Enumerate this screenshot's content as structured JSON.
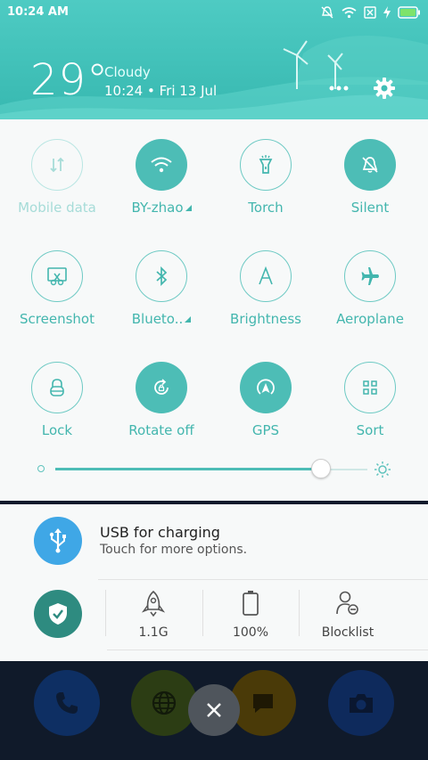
{
  "status_bar": {
    "time": "10:24 AM"
  },
  "header": {
    "temperature": "29°",
    "condition": "Cloudy",
    "datetime": "10:24 • Fri 13 Jul"
  },
  "tiles": [
    {
      "label": "Mobile data",
      "icon": "mobile-data-icon",
      "state": "disabled"
    },
    {
      "label": "BY-zhao",
      "icon": "wifi-icon",
      "state": "on",
      "expandable": true
    },
    {
      "label": "Torch",
      "icon": "torch-icon",
      "state": "off"
    },
    {
      "label": "Silent",
      "icon": "silent-icon",
      "state": "on"
    },
    {
      "label": "Screenshot",
      "icon": "screenshot-icon",
      "state": "off"
    },
    {
      "label": "Blueto..",
      "icon": "bluetooth-icon",
      "state": "off",
      "expandable": true
    },
    {
      "label": "Brightness",
      "icon": "brightness-auto-icon",
      "state": "off"
    },
    {
      "label": "Aeroplane",
      "icon": "aeroplane-icon",
      "state": "off"
    },
    {
      "label": "Lock",
      "icon": "lock-icon",
      "state": "off"
    },
    {
      "label": "Rotate off",
      "icon": "rotate-lock-icon",
      "state": "on"
    },
    {
      "label": "GPS",
      "icon": "gps-icon",
      "state": "on"
    },
    {
      "label": "Sort",
      "icon": "sort-grid-icon",
      "state": "off"
    }
  ],
  "brightness": {
    "level": 0.85
  },
  "notification": {
    "title": "USB for charging",
    "subtitle": "Touch for more options."
  },
  "security": {
    "memory": "1.1G",
    "battery": "100%",
    "blocklist": "Blocklist"
  },
  "colors": {
    "accent": "#4dbdb6",
    "header": "#3fbeb6",
    "usb": "#3fa7e6",
    "shield": "#2e8b80"
  }
}
